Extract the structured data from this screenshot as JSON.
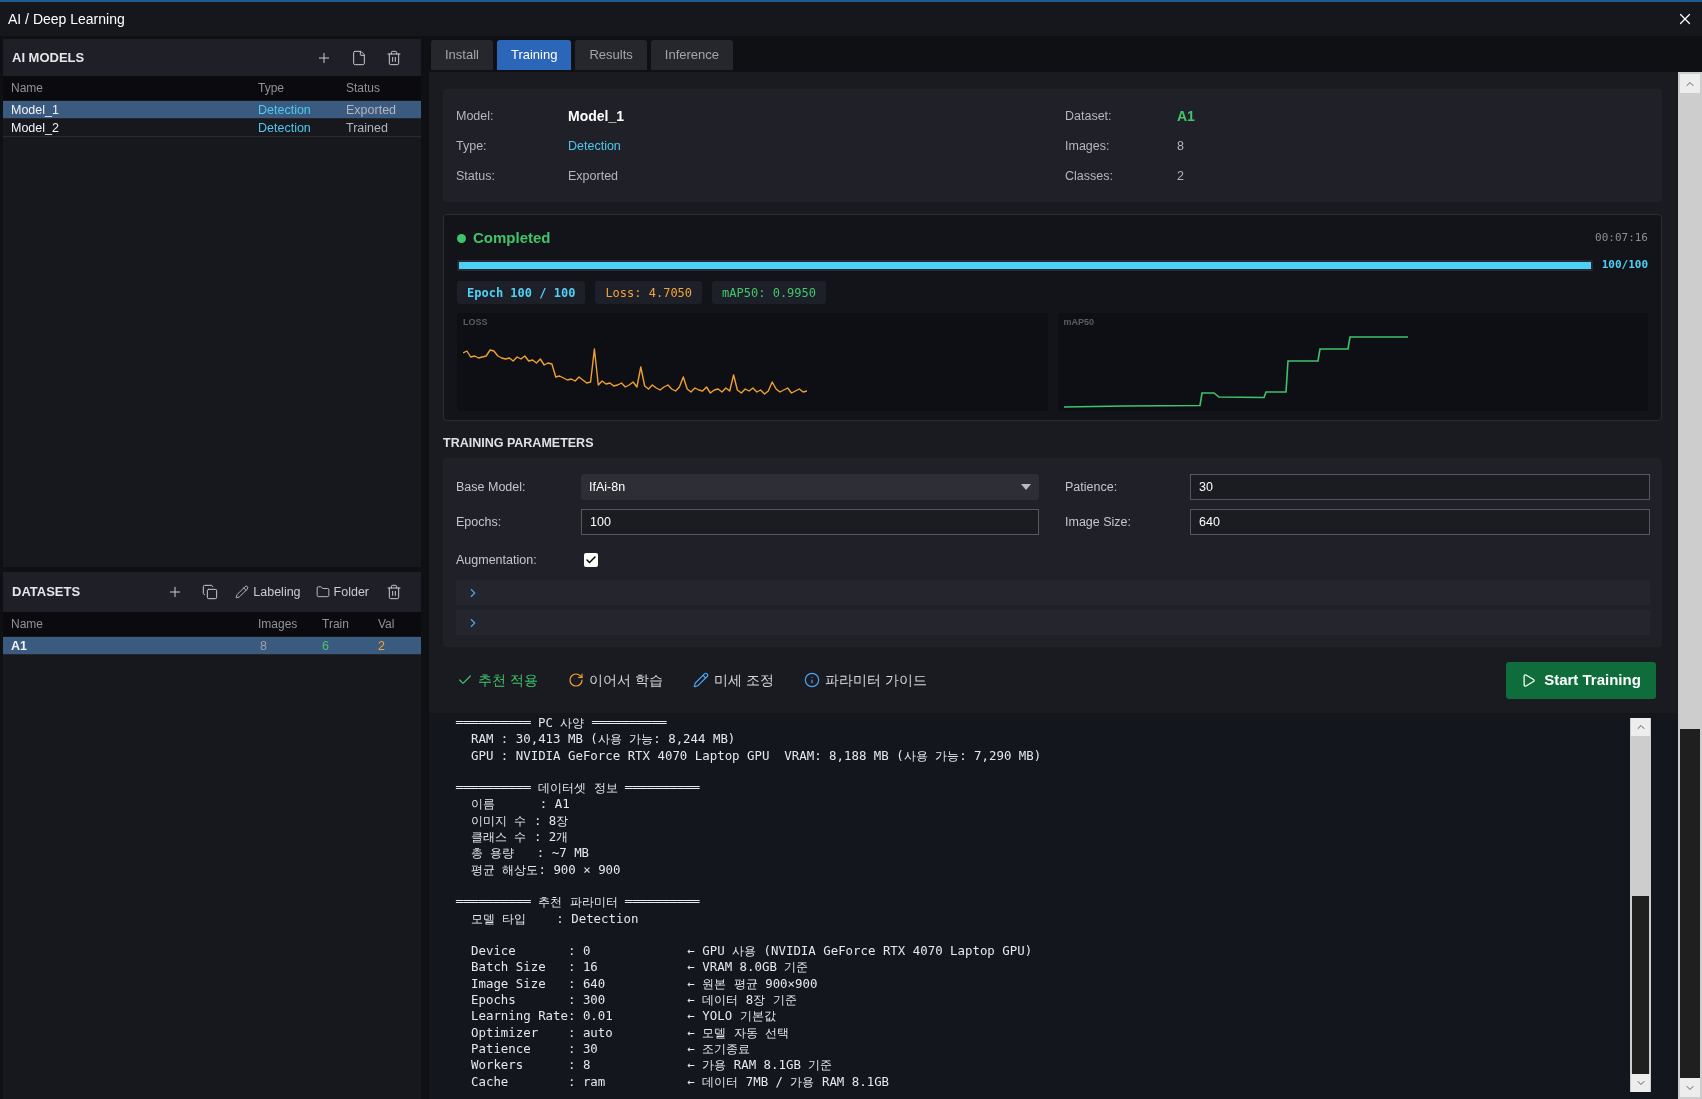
{
  "window": {
    "title": "AI / Deep Learning"
  },
  "models_panel": {
    "title": "AI MODELS",
    "columns": [
      "Name",
      "Type",
      "Status"
    ],
    "rows": [
      {
        "name": "Model_1",
        "type": "Detection",
        "status": "Exported",
        "selected": true
      },
      {
        "name": "Model_2",
        "type": "Detection",
        "status": "Trained",
        "selected": false
      }
    ]
  },
  "datasets_panel": {
    "title": "DATASETS",
    "tools": [
      {
        "kind": "labeling",
        "label": "Labeling"
      },
      {
        "kind": "folder",
        "label": "Folder"
      }
    ],
    "columns": [
      "Name",
      "Images",
      "Train",
      "Val"
    ],
    "rows": [
      {
        "name": "A1",
        "images": "8",
        "train": "6",
        "val": "2",
        "selected": true
      }
    ]
  },
  "tabs": [
    {
      "label": "Install",
      "selected": false
    },
    {
      "label": "Training",
      "selected": true
    },
    {
      "label": "Results",
      "selected": false
    },
    {
      "label": "Inference",
      "selected": false
    }
  ],
  "model_info": {
    "left": [
      {
        "label": "Model:",
        "value": "Model_1",
        "kind": "name"
      },
      {
        "label": "Type:",
        "value": "Detection",
        "kind": "type"
      },
      {
        "label": "Status:",
        "value": "Exported",
        "kind": "plain"
      }
    ],
    "right": [
      {
        "label": "Dataset:",
        "value": "A1",
        "kind": "dataset"
      },
      {
        "label": "Images:",
        "value": "8",
        "kind": "plain"
      },
      {
        "label": "Classes:",
        "value": "2",
        "kind": "plain"
      }
    ]
  },
  "progress": {
    "kind": "completed",
    "status": "Completed",
    "elapsed": "00:07:16",
    "level": 1,
    "count": "100/100",
    "badges": [
      {
        "kind": "epoch",
        "text": "Epoch 100 / 100",
        "color": "#4fd0f5"
      },
      {
        "kind": "loss",
        "text": "Loss: 4.7050",
        "color": "#f2a33a"
      },
      {
        "kind": "map",
        "text": "mAP50: 0.9950",
        "color": "#43c66a"
      }
    ],
    "charts": [
      {
        "kind": "loss",
        "title": "LOSS"
      },
      {
        "kind": "map",
        "title": "mAP50"
      }
    ]
  },
  "training_parameters": {
    "title": "TRAINING PARAMETERS",
    "fields": [
      {
        "kind": "select",
        "label": "Base Model:",
        "value": "IfAi-8n"
      },
      {
        "kind": "input",
        "label": "Patience:",
        "value": "30"
      },
      {
        "kind": "input",
        "label": "Epochs:",
        "value": "100"
      },
      {
        "kind": "input",
        "label": "Image Size:",
        "value": "640"
      }
    ],
    "augmentation": {
      "label": "Augmentation:",
      "checked": true
    },
    "sections": [
      {
        "expanded": false
      },
      {
        "expanded": false
      }
    ]
  },
  "actions": [
    {
      "kind": "apply",
      "label": "추천 적용"
    },
    {
      "kind": "resume",
      "label": "이어서 학습"
    },
    {
      "kind": "tune",
      "label": "미세 조정"
    },
    {
      "kind": "guide",
      "label": "파라미터 가이드"
    }
  ],
  "start_button": {
    "label": "Start Training"
  },
  "console": {
    "blocks": [
      {
        "heading": "══════════ PC 사양 ══════════",
        "lines": [
          "RAM : 30,413 MB (사용 가능: 8,244 MB)",
          "GPU : NVIDIA GeForce RTX 4070 Laptop GPU  VRAM: 8,188 MB (사용 가능: 7,290 MB)"
        ]
      },
      {
        "heading": "══════════ 데이터셋 정보 ══════════",
        "lines": [
          "이름      : A1",
          "이미지 수 : 8장",
          "클래스 수 : 2개",
          "총 용량   : ~7 MB",
          "평균 해상도: 900 × 900"
        ]
      },
      {
        "heading": "══════════ 추천 파라미터 ══════════",
        "lines": [
          "모델 타입    : Detection"
        ]
      },
      {
        "lines": [
          "Device       : 0             ← GPU 사용 (NVIDIA GeForce RTX 4070 Laptop GPU)",
          "Batch Size   : 16            ← VRAM 8.0GB 기준",
          "Image Size   : 640           ← 원본 평균 900×900",
          "Epochs       : 300           ← 데이터 8장 기준",
          "Learning Rate: 0.01          ← YOLO 기본값",
          "Optimizer    : auto          ← 모델 자동 선택",
          "Patience     : 30            ← 조기종료",
          "Workers      : 8             ← 가용 RAM 8.1GB 기준",
          "Cache        : ram           ← 데이터 7MB / 가용 RAM 8.1GB"
        ]
      }
    ]
  }
}
